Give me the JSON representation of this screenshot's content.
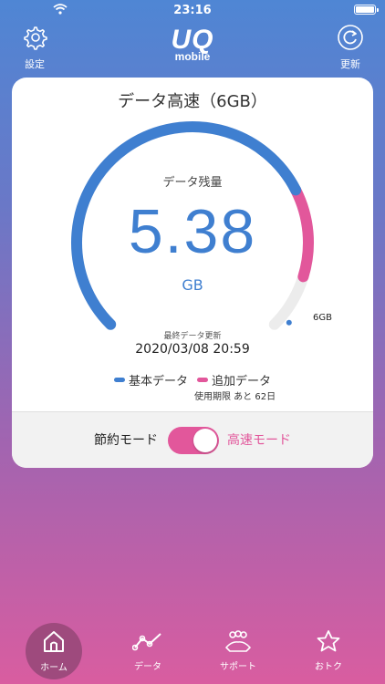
{
  "status": {
    "time": "23:16"
  },
  "header": {
    "settings_label": "設定",
    "refresh_label": "更新",
    "logo_uq": "UQ",
    "logo_mobile": "mobile"
  },
  "card": {
    "title": "データ高速（6GB）",
    "remaining_label": "データ残量",
    "remaining_value": "5.38",
    "remaining_unit": "GB",
    "max_label": "6GB",
    "updated_label": "最終データ更新",
    "updated_value": "2020/03/08 20:59",
    "legend": {
      "basic": "基本データ",
      "extra": "追加データ"
    },
    "expiry": "使用期限 あと 62日",
    "gauge": {
      "max_gb": 6,
      "basic_gb": 4.4,
      "extra_gb": 0.98
    }
  },
  "mode": {
    "left_label": "節約モード",
    "right_label": "高速モード",
    "toggle_on": true
  },
  "tabs": {
    "home": "ホーム",
    "data": "データ",
    "support": "サポート",
    "deals": "おトク"
  },
  "colors": {
    "basic": "#3f7fd0",
    "extra": "#e2579b",
    "track": "#ececec"
  }
}
